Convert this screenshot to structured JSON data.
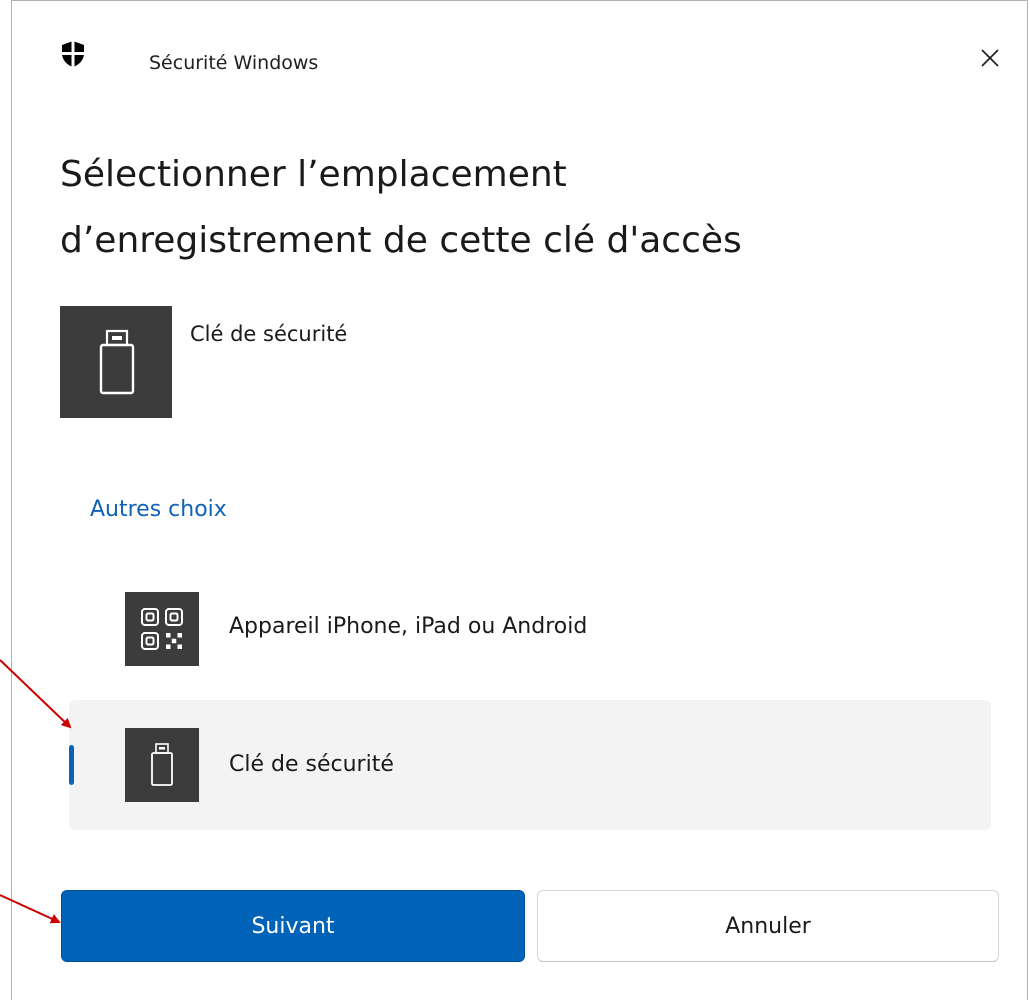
{
  "window": {
    "title": "Sécurité Windows",
    "close_icon": "close-icon",
    "shield_icon": "shield-icon"
  },
  "heading": {
    "line1": "Sélectionner l’emplacement",
    "line2": "d’enregistrement de cette clé d'accès"
  },
  "primary_option": {
    "label": "Clé de sécurité",
    "icon": "usb-key-icon"
  },
  "other_choices": {
    "label": "Autres choix",
    "items": [
      {
        "label": "Appareil iPhone, iPad ou Android",
        "icon": "qr-code-icon",
        "selected": false
      },
      {
        "label": "Clé de sécurité",
        "icon": "usb-key-icon",
        "selected": true
      }
    ]
  },
  "buttons": {
    "next_label": "Suivant",
    "cancel_label": "Annuler"
  },
  "colors": {
    "accent": "#0063b8",
    "link": "#0f62b8",
    "tile": "#3c3c3c",
    "selected_bg": "#f3f3f3",
    "annotation_arrow": "#cc0000"
  }
}
